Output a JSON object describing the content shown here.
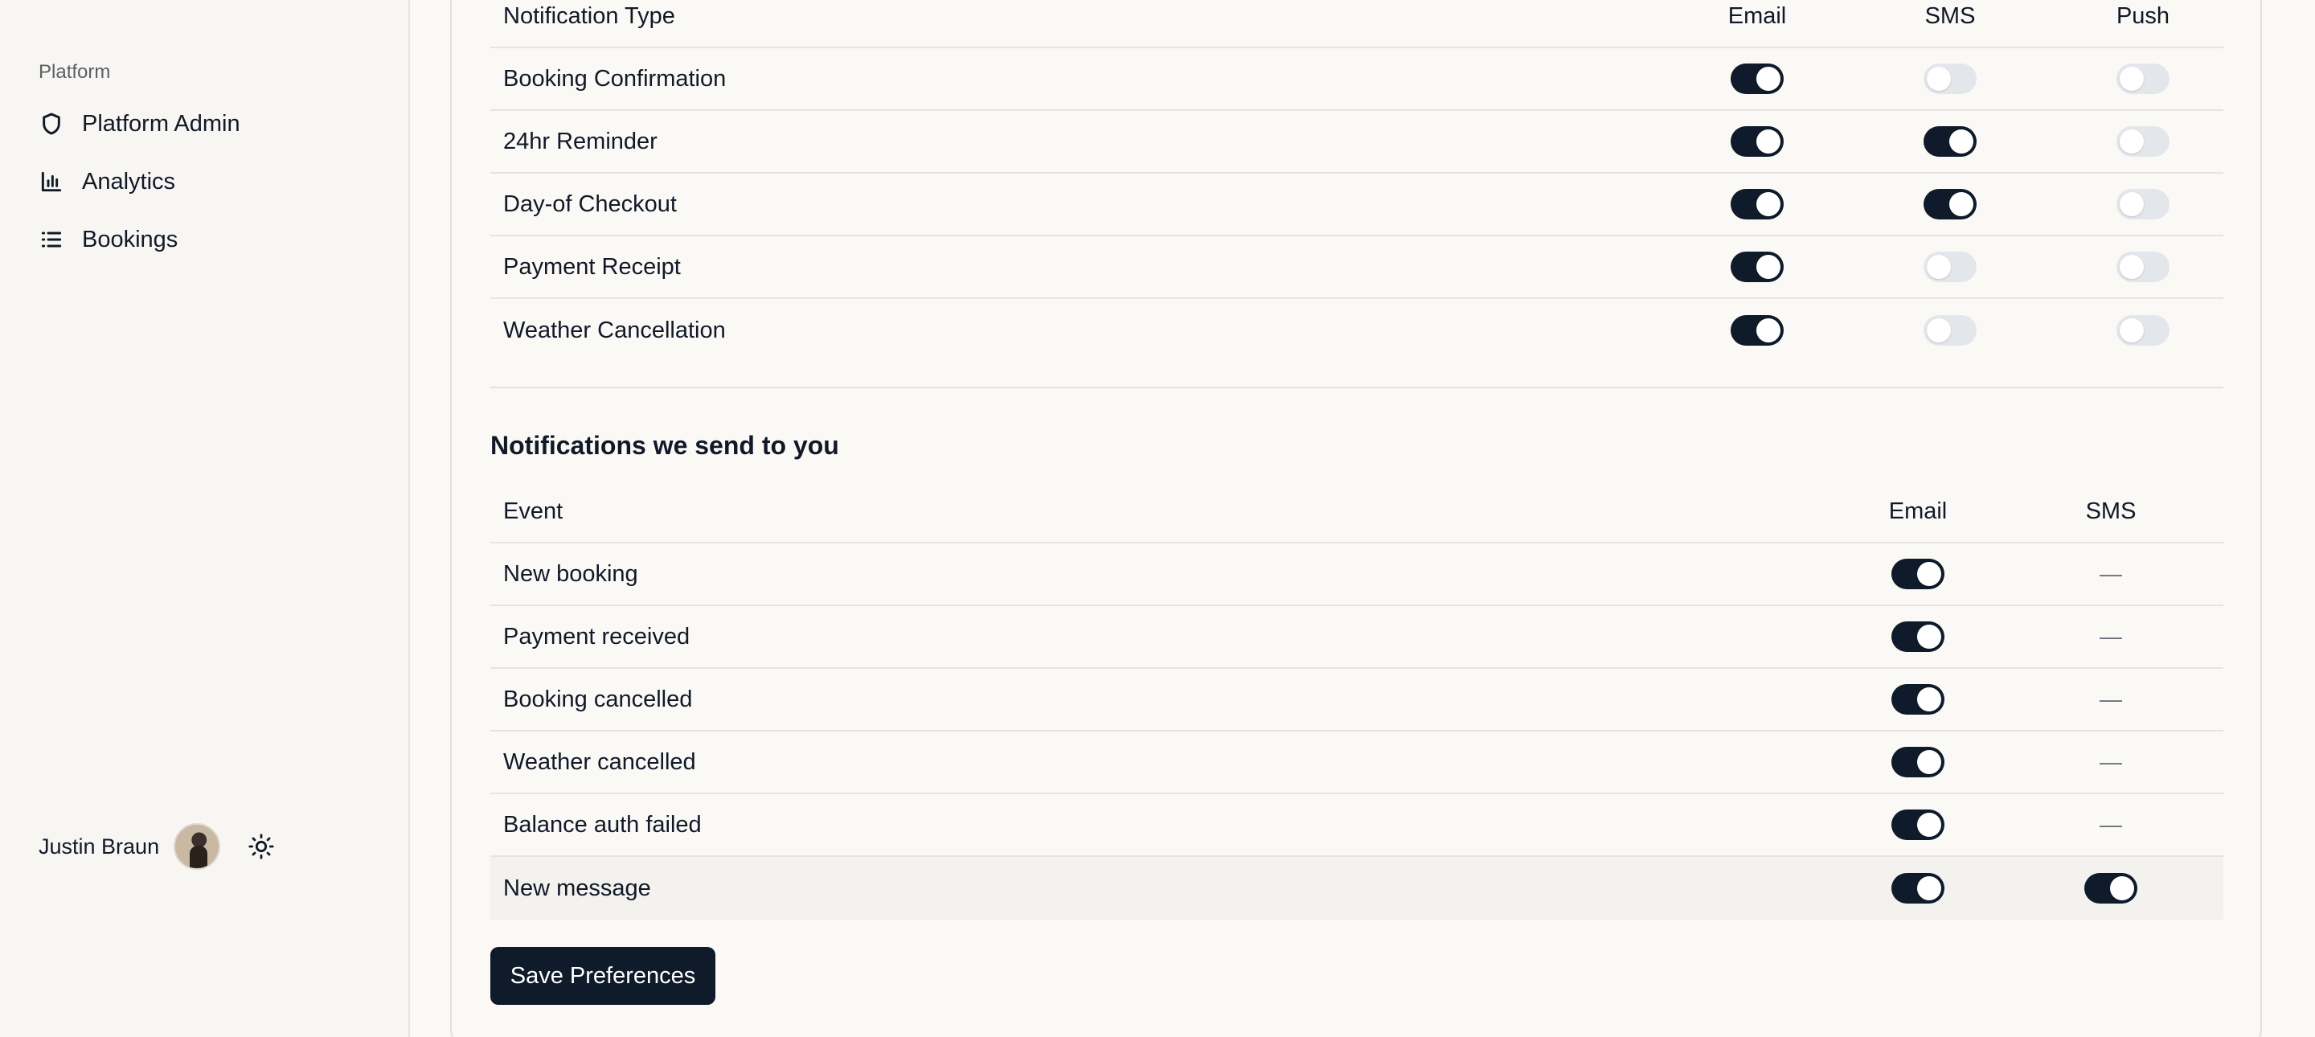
{
  "sidebar": {
    "section_label": "Platform",
    "items": [
      {
        "label": "Platform Admin",
        "icon": "shield-icon"
      },
      {
        "label": "Analytics",
        "icon": "bar-chart-icon"
      },
      {
        "label": "Bookings",
        "icon": "list-icon"
      }
    ],
    "user": {
      "name": "Justin Braun"
    }
  },
  "customer_notifications": {
    "headers": {
      "type": "Notification Type",
      "email": "Email",
      "sms": "SMS",
      "push": "Push"
    },
    "rows": [
      {
        "label": "Booking Confirmation",
        "email": true,
        "sms": false,
        "push": false
      },
      {
        "label": "24hr Reminder",
        "email": true,
        "sms": true,
        "push": false
      },
      {
        "label": "Day-of Checkout",
        "email": true,
        "sms": true,
        "push": false
      },
      {
        "label": "Payment Receipt",
        "email": true,
        "sms": false,
        "push": false
      },
      {
        "label": "Weather Cancellation",
        "email": true,
        "sms": false,
        "push": false
      }
    ]
  },
  "owner_notifications": {
    "title": "Notifications we send to you",
    "headers": {
      "event": "Event",
      "email": "Email",
      "sms": "SMS"
    },
    "unavailable_mark": "—",
    "rows": [
      {
        "label": "New booking",
        "email": true,
        "sms": null
      },
      {
        "label": "Payment received",
        "email": true,
        "sms": null
      },
      {
        "label": "Booking cancelled",
        "email": true,
        "sms": null
      },
      {
        "label": "Weather cancelled",
        "email": true,
        "sms": null
      },
      {
        "label": "Balance auth failed",
        "email": true,
        "sms": null
      },
      {
        "label": "New message",
        "email": true,
        "sms": true
      }
    ]
  },
  "save_button": {
    "label": "Save Preferences"
  },
  "colors": {
    "toggle_on": "#0f1b2a",
    "toggle_off": "#e3e6eb",
    "background": "#faf9f6"
  }
}
